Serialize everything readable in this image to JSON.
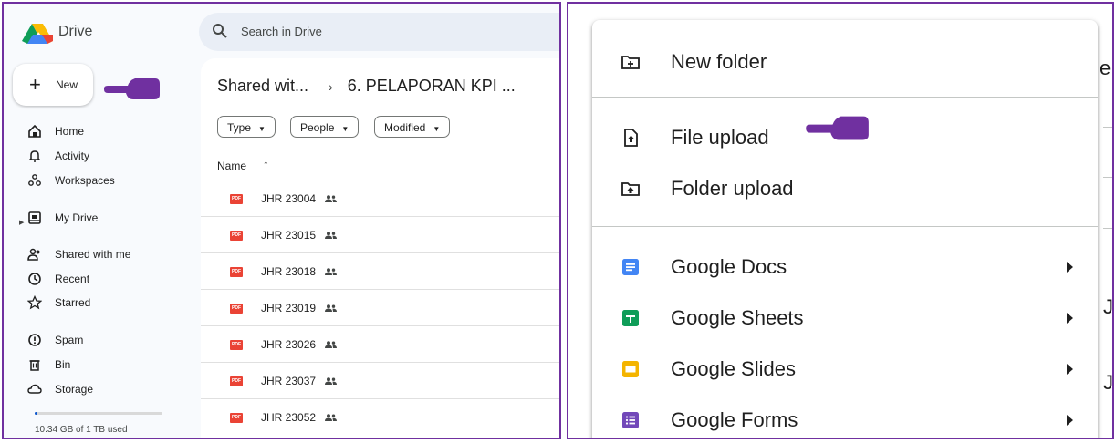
{
  "app": {
    "brand": "Drive"
  },
  "search": {
    "placeholder": "Search in Drive"
  },
  "new_button": {
    "label": "New"
  },
  "sidebar": {
    "items": [
      {
        "label": "Home",
        "icon": "home-icon"
      },
      {
        "label": "Activity",
        "icon": "bell-icon"
      },
      {
        "label": "Workspaces",
        "icon": "workspaces-icon"
      },
      {
        "label": "My Drive",
        "icon": "drive-icon"
      },
      {
        "label": "Shared with me",
        "icon": "people-icon"
      },
      {
        "label": "Recent",
        "icon": "clock-icon"
      },
      {
        "label": "Starred",
        "icon": "star-icon"
      },
      {
        "label": "Spam",
        "icon": "spam-icon"
      },
      {
        "label": "Bin",
        "icon": "trash-icon"
      },
      {
        "label": "Storage",
        "icon": "cloud-icon"
      }
    ],
    "storage_used_fraction": 0.01,
    "storage_text": "10.34 GB of 1 TB used"
  },
  "breadcrumb": {
    "root": "Shared wit...",
    "separator": "›",
    "current": "6. PELAPORAN KPI ..."
  },
  "filters": [
    {
      "label": "Type"
    },
    {
      "label": "People"
    },
    {
      "label": "Modified"
    }
  ],
  "list": {
    "column": "Name",
    "sort": "↑",
    "files": [
      {
        "name": "JHR 23004",
        "type_badge": "PDF"
      },
      {
        "name": "JHR 23015",
        "type_badge": "PDF"
      },
      {
        "name": "JHR 23018",
        "type_badge": "PDF"
      },
      {
        "name": "JHR 23019",
        "type_badge": "PDF"
      },
      {
        "name": "JHR 23026",
        "type_badge": "PDF"
      },
      {
        "name": "JHR 23037",
        "type_badge": "PDF"
      },
      {
        "name": "JHR 23052",
        "type_badge": "PDF"
      }
    ]
  },
  "new_menu": {
    "items": [
      {
        "label": "New folder",
        "icon": "new-folder-icon"
      },
      {
        "label": "File upload",
        "icon": "file-upload-icon"
      },
      {
        "label": "Folder upload",
        "icon": "folder-upload-icon"
      },
      {
        "label": "Google Docs",
        "icon": "google-docs-icon",
        "color": "#4285f4"
      },
      {
        "label": "Google Sheets",
        "icon": "google-sheets-icon",
        "color": "#0f9d58"
      },
      {
        "label": "Google Slides",
        "icon": "google-slides-icon",
        "color": "#f4b400"
      },
      {
        "label": "Google Forms",
        "icon": "google-forms-icon",
        "color": "#7248b9"
      }
    ]
  },
  "background_fragments": {
    "a": "e",
    "b": "J",
    "c": "J"
  },
  "colors": {
    "panel_border": "#7030a0",
    "pointer_hand": "#7030a0",
    "accent": "#0b57d0"
  }
}
